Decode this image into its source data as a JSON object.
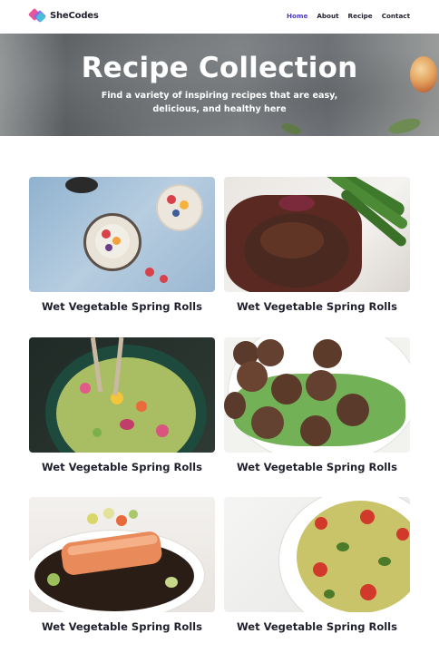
{
  "brand": {
    "name": "SheCodes"
  },
  "nav": {
    "links": [
      {
        "label": "Home",
        "active": true
      },
      {
        "label": "About",
        "active": false
      },
      {
        "label": "Recipe",
        "active": false
      },
      {
        "label": "Contact",
        "active": false
      }
    ]
  },
  "hero": {
    "title": "Recipe Collection",
    "subtitle": "Find a variety of inspiring recipes that are easy, delicious, and healthy here"
  },
  "recipes": [
    {
      "title": "Wet Vegetable Spring Rolls",
      "image": "yogurt-fruit-bowls"
    },
    {
      "title": "Wet Vegetable Spring Rolls",
      "image": "steak-with-asparagus"
    },
    {
      "title": "Wet Vegetable Spring Rolls",
      "image": "vegetable-salad-bowl"
    },
    {
      "title": "Wet Vegetable Spring Rolls",
      "image": "meatballs-with-arugula"
    },
    {
      "title": "Wet Vegetable Spring Rolls",
      "image": "salmon-with-vegetables"
    },
    {
      "title": "Wet Vegetable Spring Rolls",
      "image": "pasta-salad"
    }
  ],
  "colors": {
    "accent": "#4b3bc9",
    "text": "#1f1f2e"
  }
}
